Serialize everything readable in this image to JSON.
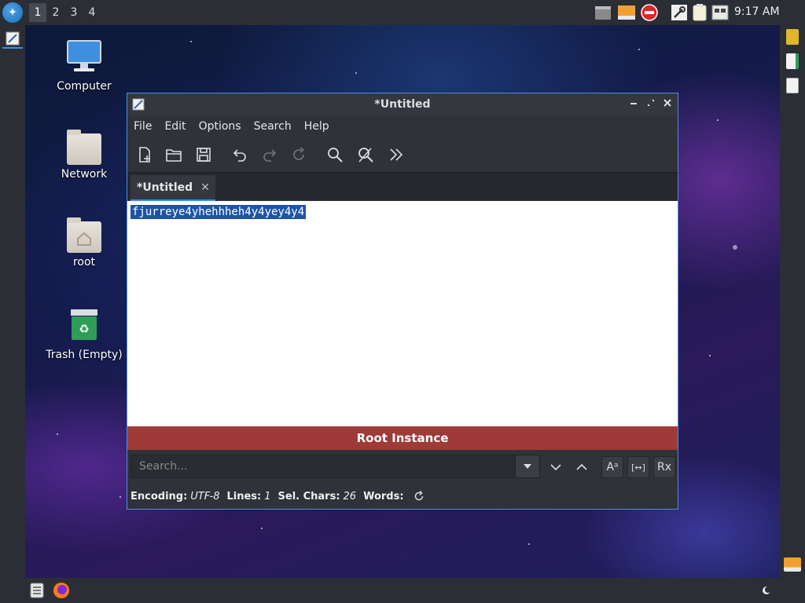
{
  "top_panel": {
    "workspaces": [
      "1",
      "2",
      "3",
      "4"
    ],
    "clock": "9:17 AM"
  },
  "desktop": {
    "icons": [
      {
        "label": "Computer"
      },
      {
        "label": "Network"
      },
      {
        "label": "root"
      },
      {
        "label": "Trash (Empty)"
      }
    ]
  },
  "window": {
    "title": "*Untitled",
    "menu": [
      "File",
      "Edit",
      "Options",
      "Search",
      "Help"
    ],
    "tab_label": "*Untitled",
    "tab_close": "✕",
    "editor_text": "fjurreye4yhehhheh4y4yey4y4",
    "instance_label": "Root Instance",
    "search": {
      "placeholder": "Search...",
      "case_button": "Aᵃ",
      "whole_word_button": "[↔]",
      "regex_button": "Rx"
    },
    "status": {
      "encoding_label": "Encoding:",
      "encoding_value": "UTF-8",
      "lines_label": "Lines:",
      "lines_value": "1",
      "sel_label": "Sel. Chars:",
      "sel_value": "26",
      "words_label": "Words:"
    }
  },
  "colors": {
    "accent": "#3d8ee0",
    "selection": "#1d54a8",
    "instance_bar": "#9e3a37",
    "panel": "#2b2e35"
  }
}
